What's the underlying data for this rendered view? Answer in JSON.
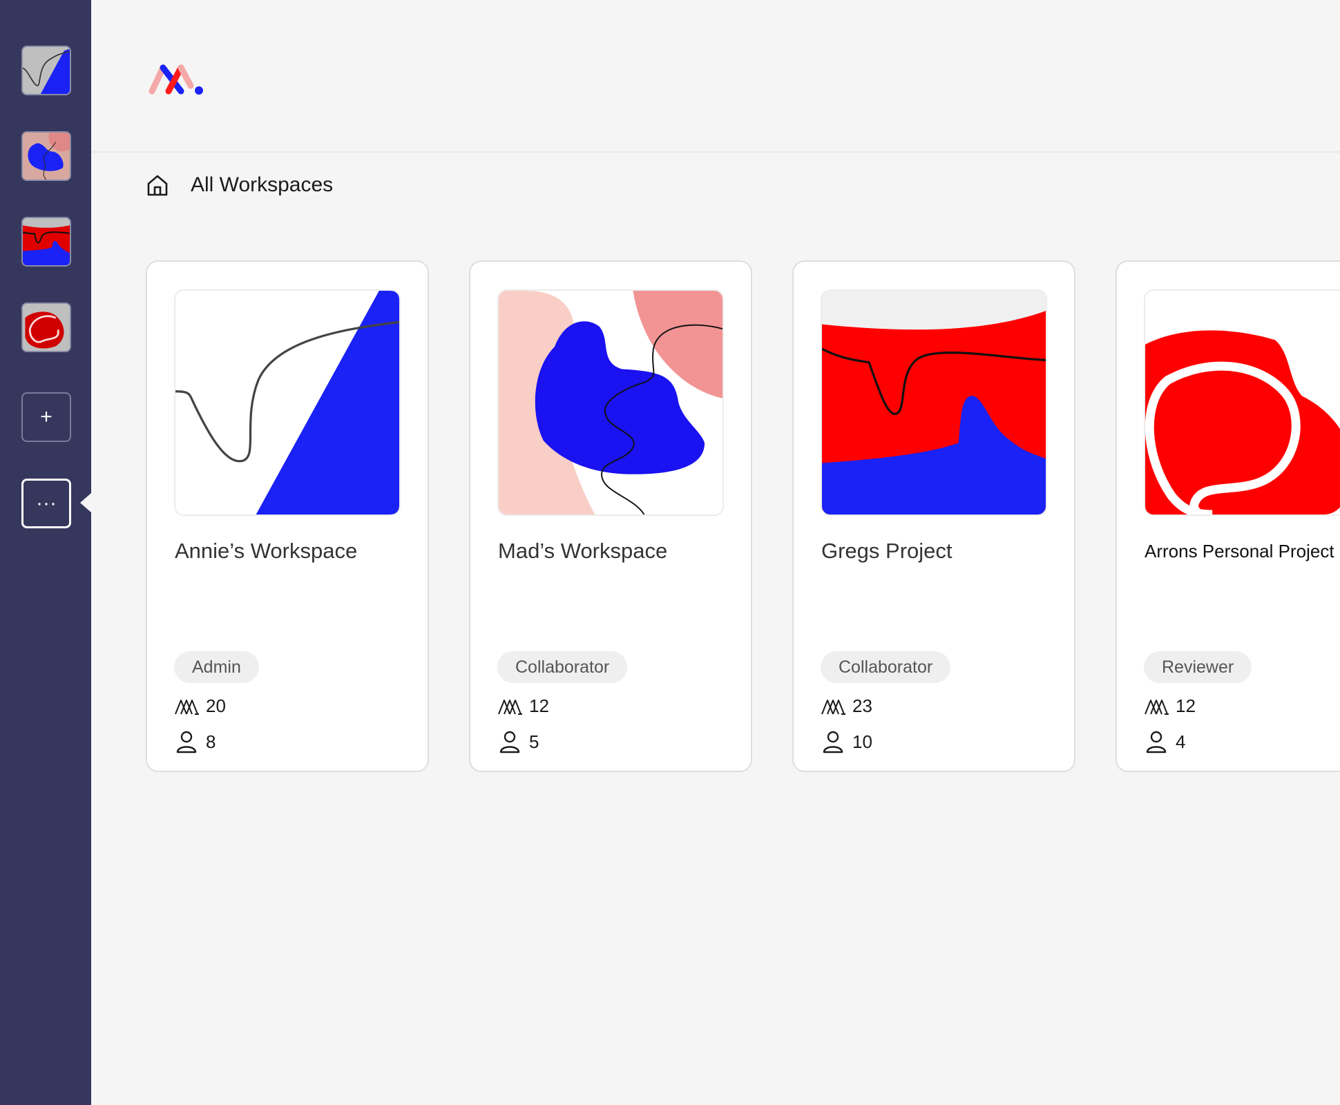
{
  "sidebar": {
    "workspaces": [
      {
        "icon": "workspace-thumb-annie"
      },
      {
        "icon": "workspace-thumb-mad"
      },
      {
        "icon": "workspace-thumb-greg"
      },
      {
        "icon": "workspace-thumb-arron"
      }
    ],
    "add_label": "+",
    "more_label": "···"
  },
  "breadcrumb": {
    "icon": "home-icon",
    "title": "All Workspaces"
  },
  "colors": {
    "sidebar": "#35375c",
    "blue": "#1a22f5",
    "red": "#ff0000",
    "pink": "#f9c9c1",
    "salmon": "#f29494"
  },
  "workspaces": [
    {
      "name": "Annie’s Workspace",
      "role": "Admin",
      "projects": "20",
      "members": "8"
    },
    {
      "name": "Mad’s Workspace",
      "role": "Collaborator",
      "projects": "12",
      "members": "5"
    },
    {
      "name": "Gregs Project",
      "role": "Collaborator",
      "projects": "23",
      "members": "10"
    },
    {
      "name": "Arrons Personal Project Folder",
      "role": "Reviewer",
      "projects": "12",
      "members": "4"
    }
  ]
}
